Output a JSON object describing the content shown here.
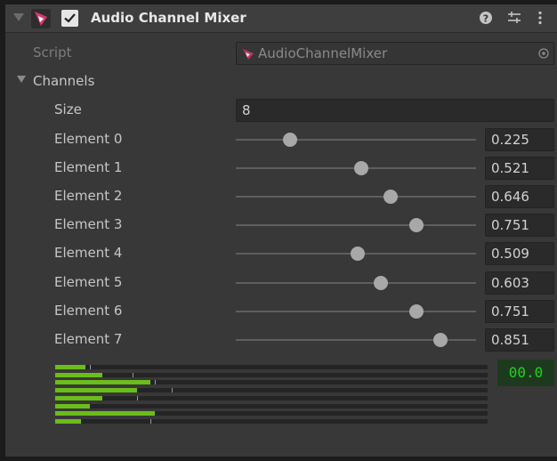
{
  "header": {
    "title": "Audio Channel Mixer",
    "enabled": true,
    "icons": [
      "help-icon",
      "preset-icon",
      "more-menu-icon"
    ]
  },
  "script_row": {
    "label": "Script",
    "value": "AudioChannelMixer"
  },
  "channels": {
    "label": "Channels",
    "size_label": "Size",
    "size_value": "8",
    "elements": [
      {
        "label": "Element 0",
        "value": "0.225",
        "level": 0.225
      },
      {
        "label": "Element 1",
        "value": "0.521",
        "level": 0.521
      },
      {
        "label": "Element 2",
        "value": "0.646",
        "level": 0.646
      },
      {
        "label": "Element 3",
        "value": "0.751",
        "level": 0.751
      },
      {
        "label": "Element 4",
        "value": "0.509",
        "level": 0.509
      },
      {
        "label": "Element 5",
        "value": "0.603",
        "level": 0.603
      },
      {
        "label": "Element 6",
        "value": "0.751",
        "level": 0.751
      },
      {
        "label": "Element 7",
        "value": "0.851",
        "level": 0.851
      }
    ]
  },
  "meters": {
    "levels": [
      0.07,
      0.11,
      0.22,
      0.19,
      0.11,
      0.08,
      0.23,
      0.06
    ],
    "peaks": [
      0.08,
      0.18,
      0.23,
      0.27,
      0.19,
      0.0,
      0.0,
      0.22
    ],
    "readout": "00.0"
  },
  "colors": {
    "panel": "#383838",
    "meter_green": "#6bbd1a",
    "readout_green": "#21d321",
    "logo": "#d93a6b"
  }
}
